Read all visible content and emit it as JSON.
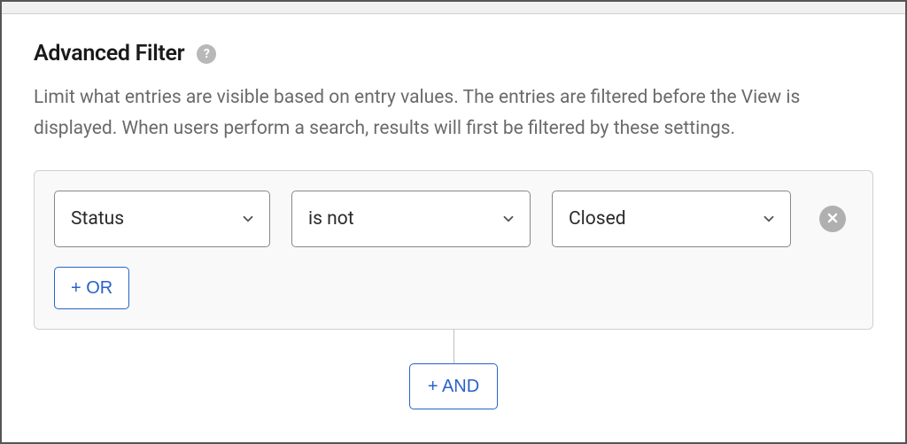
{
  "header": {
    "title": "Advanced Filter",
    "help_tooltip": "?"
  },
  "description": "Limit what entries are visible based on entry values. The entries are filtered before the View is displayed. When users perform a search, results will first be filtered by these settings.",
  "filter": {
    "rows": [
      {
        "field": "Status",
        "operator": "is not",
        "value": "Closed"
      }
    ],
    "or_label": "+ OR",
    "and_label": "+ AND"
  }
}
